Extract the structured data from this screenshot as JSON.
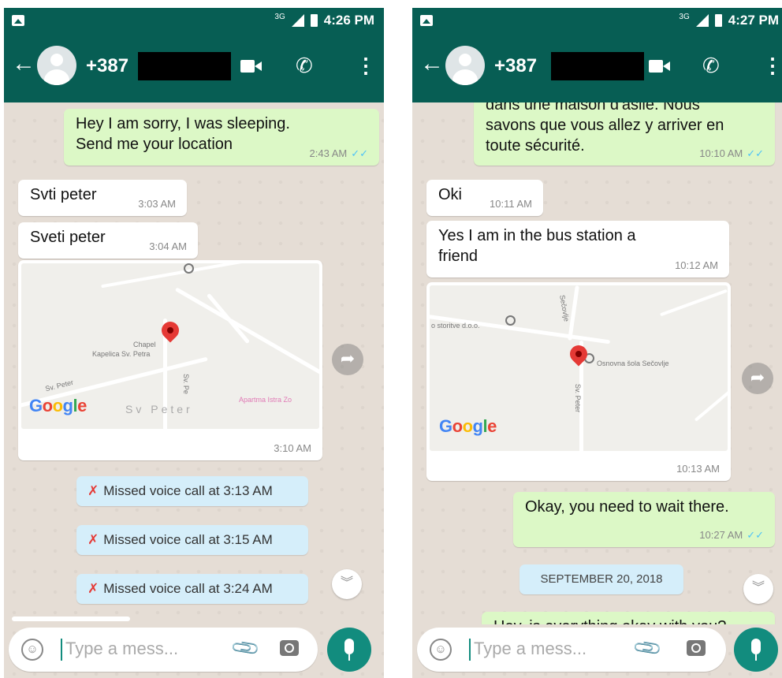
{
  "left": {
    "status": {
      "network": "3G",
      "time": "4:26 PM"
    },
    "header": {
      "back": "←",
      "contact": "+387",
      "call_icon": "✆",
      "menu": "⋮"
    },
    "messages": [
      {
        "id": "m1",
        "dir": "out",
        "lines": [
          "Hey I am sorry, I was sleeping.",
          "Send me your location"
        ],
        "time": "2:43 AM",
        "read": true
      },
      {
        "id": "m2",
        "dir": "in",
        "text": "Svti  peter",
        "time": "3:03 AM"
      },
      {
        "id": "m3",
        "dir": "in",
        "text": "Sveti  peter",
        "time": "3:04 AM"
      }
    ],
    "map": {
      "time": "3:10 AM",
      "labels": {
        "chapel": "Chapel",
        "kapelica": "Kapelica Sv. Petra",
        "sv_peter": "Sv  Peter",
        "apartma": "Apartma Istra Zo",
        "road1": "Sv. Peter",
        "road2": "Sv. Pe"
      }
    },
    "missed_calls": [
      "Missed voice call at 3:13 AM",
      "Missed voice call at 3:15 AM",
      "Missed voice call at 3:24 AM"
    ],
    "input": {
      "placeholder": "Type a mess..."
    }
  },
  "right": {
    "status": {
      "network": "3G",
      "time": "4:27 PM"
    },
    "header": {
      "back": "←",
      "contact": "+387",
      "call_icon": "✆",
      "menu": "⋮"
    },
    "messages": [
      {
        "id": "r1",
        "dir": "out",
        "lines": [
          "dans une maison d'asile. Nous",
          "savons que vous allez y arriver en",
          "toute sécurité."
        ],
        "time": "10:10 AM",
        "read": true
      },
      {
        "id": "r2",
        "dir": "in",
        "text": "Oki",
        "time": "10:11 AM"
      },
      {
        "id": "r3",
        "dir": "in",
        "lines": [
          "Yes I am in the bus station a",
          "friend"
        ],
        "time": "10:12 AM"
      },
      {
        "id": "r4",
        "dir": "out",
        "text": "Okay, you need to wait there.",
        "time": "10:27 AM",
        "read": true
      },
      {
        "id": "r5",
        "dir": "out",
        "text": "Hey, is everything okay with you?",
        "partial": true
      }
    ],
    "map": {
      "time": "10:13 AM",
      "labels": {
        "storitve": "o storitve d.o.o.",
        "school": "Osnovna šola Sečovlje",
        "road1": "Sv. Peter",
        "road2": "Sečovlje"
      }
    },
    "date_divider": "SEPTEMBER 20, 2018",
    "input": {
      "placeholder": "Type a mess..."
    }
  },
  "common": {
    "google": {
      "G": "G",
      "o1": "o",
      "o2": "o",
      "g": "g",
      "l": "l",
      "e": "e"
    },
    "forward_icon": "➦",
    "scroll_icon": "︾",
    "missed_icon": "✗",
    "emoji_icon": "☺",
    "attach_icon": "📎",
    "tick": "✓✓"
  },
  "colors": {
    "header": "#075e54",
    "accent": "#128c7e",
    "out_bubble": "#dcf8c6",
    "in_bubble": "#ffffff",
    "system_bubble": "#d5eefa",
    "tick": "#4fc3f7"
  }
}
